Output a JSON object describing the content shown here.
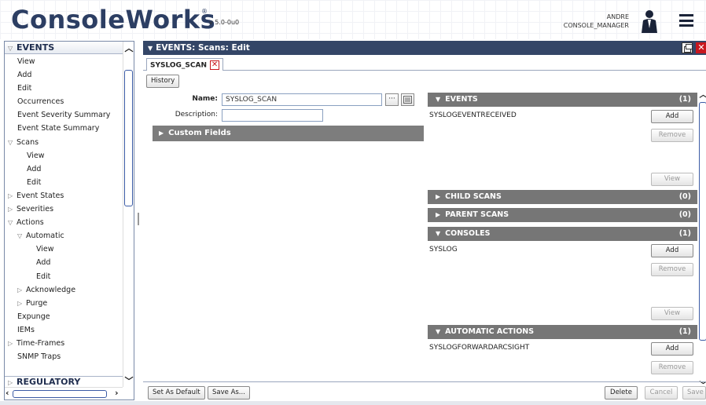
{
  "header": {
    "logo": "ConsoleWorks",
    "reg_mark": "®",
    "version": "v 5.0-0u0",
    "user_name": "ANDRE",
    "user_role": "CONSOLE_MANAGER"
  },
  "sidebar": {
    "top_section": "EVENTS",
    "items": [
      {
        "label": "View",
        "indent": 1,
        "arrow": ""
      },
      {
        "label": "Add",
        "indent": 1,
        "arrow": ""
      },
      {
        "label": "Edit",
        "indent": 1,
        "arrow": ""
      },
      {
        "label": "Occurrences",
        "indent": 1,
        "arrow": ""
      },
      {
        "label": "Event Severity Summary",
        "indent": 1,
        "arrow": ""
      },
      {
        "label": "Event State Summary",
        "indent": 1,
        "arrow": ""
      },
      {
        "label": "Scans",
        "indent": 0,
        "arrow": "down"
      },
      {
        "label": "View",
        "indent": 2,
        "arrow": ""
      },
      {
        "label": "Add",
        "indent": 2,
        "arrow": ""
      },
      {
        "label": "Edit",
        "indent": 2,
        "arrow": ""
      },
      {
        "label": "Event States",
        "indent": 0,
        "arrow": "right"
      },
      {
        "label": "Severities",
        "indent": 0,
        "arrow": "right"
      },
      {
        "label": "Actions",
        "indent": 0,
        "arrow": "down"
      },
      {
        "label": "Automatic",
        "indent": 1,
        "arrow": "down"
      },
      {
        "label": "View",
        "indent": 3,
        "arrow": ""
      },
      {
        "label": "Add",
        "indent": 3,
        "arrow": ""
      },
      {
        "label": "Edit",
        "indent": 3,
        "arrow": ""
      },
      {
        "label": "Acknowledge",
        "indent": 1,
        "arrow": "right"
      },
      {
        "label": "Purge",
        "indent": 1,
        "arrow": "right"
      },
      {
        "label": "Expunge",
        "indent": 1,
        "arrow": ""
      },
      {
        "label": "IEMs",
        "indent": 1,
        "arrow": ""
      },
      {
        "label": "Time-Frames",
        "indent": 0,
        "arrow": "right"
      },
      {
        "label": "SNMP Traps",
        "indent": 1,
        "arrow": ""
      }
    ],
    "bottom_section": "REGULATORY"
  },
  "panel": {
    "title": "EVENTS: Scans: Edit",
    "tab_label": "SYSLOG_SCAN",
    "history_button": "History",
    "name_label": "Name:",
    "name_value": "SYSLOG_SCAN",
    "ellipsis_button": "···",
    "description_label": "Description:",
    "description_value": "",
    "custom_fields": "Custom Fields"
  },
  "sections": {
    "events": {
      "title": "EVENTS",
      "count": "(1)",
      "value": "SYSLOGEVENTRECEIVED"
    },
    "child_scans": {
      "title": "CHILD SCANS",
      "count": "(0)"
    },
    "parent_scans": {
      "title": "PARENT SCANS",
      "count": "(0)"
    },
    "consoles": {
      "title": "CONSOLES",
      "count": "(1)",
      "value": "SYSLOG"
    },
    "automatic_actions": {
      "title": "AUTOMATIC ACTIONS",
      "count": "(1)",
      "value": "SYSLOGFORWARDARCSIGHT"
    }
  },
  "buttons": {
    "add": "Add",
    "remove": "Remove",
    "view": "View",
    "set_as_default": "Set As Default",
    "save_as": "Save As...",
    "delete": "Delete",
    "cancel": "Cancel",
    "save": "Save"
  }
}
